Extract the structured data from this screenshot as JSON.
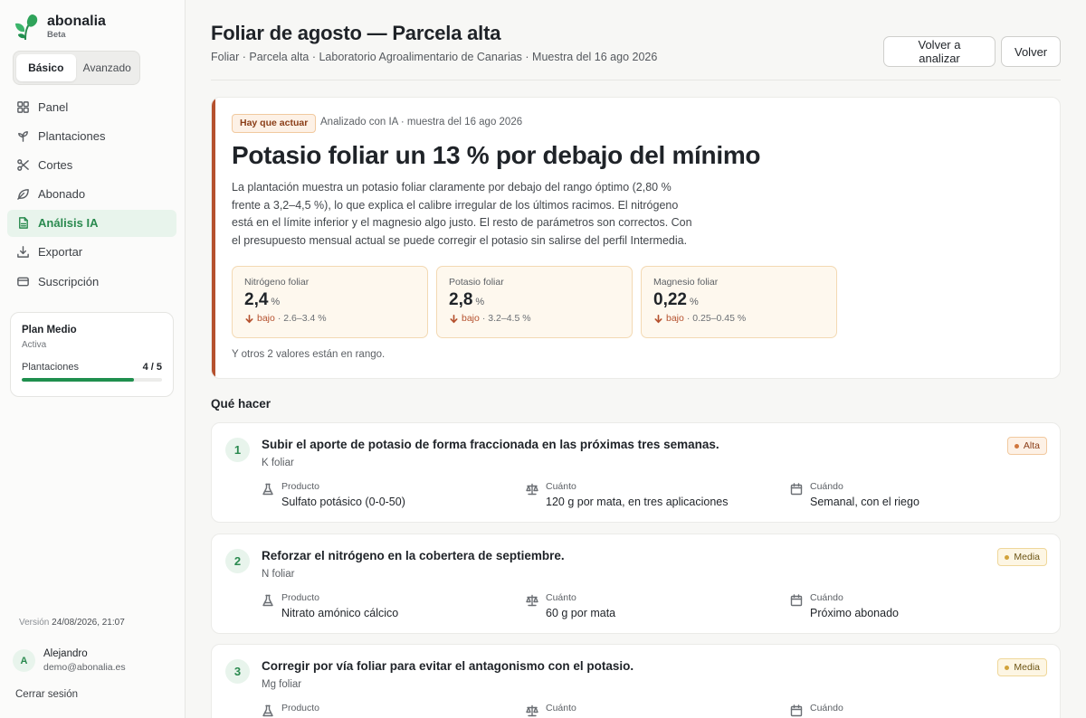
{
  "app": {
    "name": "abonalia",
    "tag": "Beta"
  },
  "mode": {
    "basic": "Básico",
    "advanced": "Avanzado"
  },
  "nav": [
    {
      "label": "Panel",
      "icon": "grid-icon"
    },
    {
      "label": "Plantaciones",
      "icon": "sprout-icon"
    },
    {
      "label": "Cortes",
      "icon": "scissors-icon"
    },
    {
      "label": "Abonado",
      "icon": "leaf-icon"
    },
    {
      "label": "Análisis IA",
      "icon": "document-icon"
    },
    {
      "label": "Exportar",
      "icon": "download-icon"
    },
    {
      "label": "Suscripción",
      "icon": "card-icon"
    }
  ],
  "plan": {
    "name": "Plan Medio",
    "status": "Activa",
    "metric_label": "Plantaciones",
    "metric_value": "4 / 5",
    "progress": 0.8
  },
  "version": {
    "label": "Versión",
    "value": "24/08/2026, 21:07"
  },
  "user": {
    "initial": "A",
    "name": "Alejandro",
    "email": "demo@abonalia.es"
  },
  "logout": "Cerrar sesión",
  "header": {
    "title": "Foliar de agosto — Parcela alta",
    "breadcrumb": "Foliar · Parcela alta · Laboratorio Agroalimentario de Canarias · Muestra del 16 ago 2026",
    "reanalyze": "Volver a analizar",
    "back": "Volver"
  },
  "summary": {
    "badge": "Hay que actuar",
    "meta": "Analizado con IA · muestra del 16 ago 2026",
    "title": "Potasio foliar un 13 % por debajo del mínimo",
    "text": "La plantación muestra un potasio foliar claramente por debajo del rango óptimo (2,80 % frente a 3,2–4,5 %), lo que explica el calibre irregular de los últimos racimos. El nitrógeno está en el límite inferior y el magnesio algo justo. El resto de parámetros son correctos. Con el presupuesto mensual actual se puede corregir el potasio sin salirse del perfil Intermedia.",
    "metrics": [
      {
        "label": "Nitrógeno foliar",
        "value": "2,4",
        "unit": "%",
        "status": "bajo",
        "range": "· 2.6–3.4 %"
      },
      {
        "label": "Potasio foliar",
        "value": "2,8",
        "unit": "%",
        "status": "bajo",
        "range": "· 3.2–4.5 %"
      },
      {
        "label": "Magnesio foliar",
        "value": "0,22",
        "unit": "%",
        "status": "bajo",
        "range": "· 0.25–0.45 %"
      }
    ],
    "rest": "Y otros 2 valores están en rango."
  },
  "actions_title": "Qué hacer",
  "field_labels": {
    "product": "Producto",
    "amount": "Cuánto",
    "when": "Cuándo"
  },
  "actions": [
    {
      "num": "1",
      "title": "Subir el aporte de potasio de forma fraccionada en las próximas tres semanas.",
      "sub": "K foliar",
      "priority": "Alta",
      "product": "Sulfato potásico (0-0-50)",
      "amount": "120 g por mata, en tres aplicaciones",
      "when": "Semanal, con el riego"
    },
    {
      "num": "2",
      "title": "Reforzar el nitrógeno en la cobertera de septiembre.",
      "sub": "N foliar",
      "priority": "Media",
      "product": "Nitrato amónico cálcico",
      "amount": "60 g por mata",
      "when": "Próximo abonado"
    },
    {
      "num": "3",
      "title": "Corregir por vía foliar para evitar el antagonismo con el potasio.",
      "sub": "Mg foliar",
      "priority": "Media",
      "product": "",
      "amount": "",
      "when": ""
    }
  ],
  "colors": {
    "accent": "#2a8a4f",
    "warning": "#b5512e",
    "progress": "#1f8f4e"
  }
}
